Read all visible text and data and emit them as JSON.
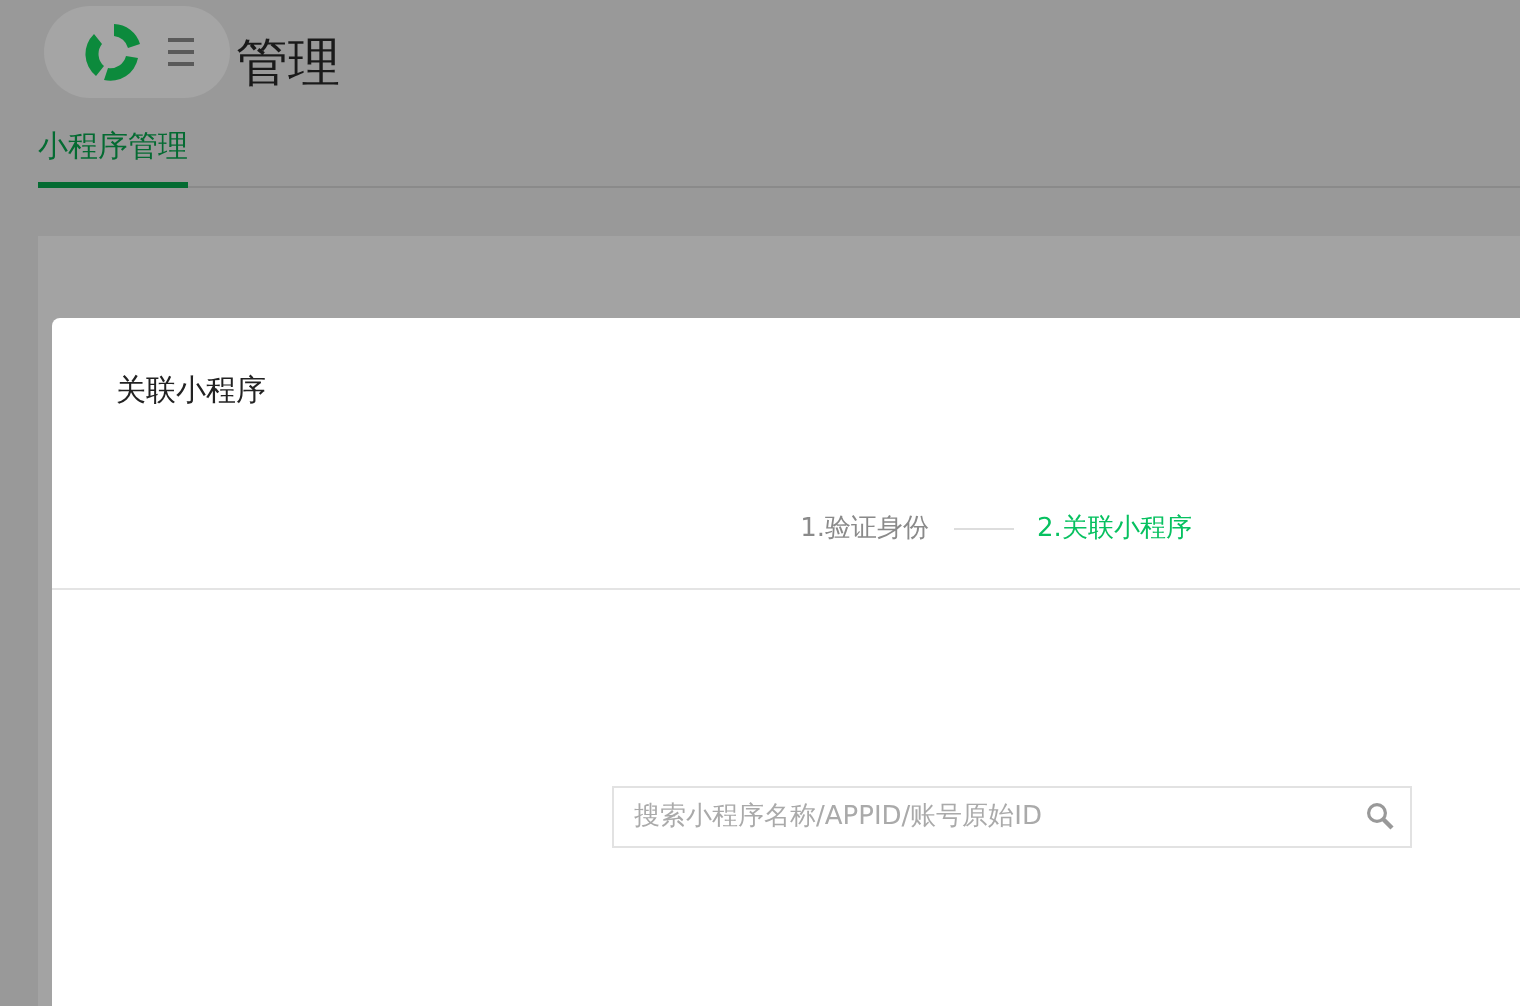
{
  "page": {
    "title": "管理"
  },
  "tabs": [
    {
      "label": "小程序管理",
      "selected": true
    }
  ],
  "dialog": {
    "title": "关联小程序",
    "steps": [
      {
        "label": "1.验证身份",
        "selected": false
      },
      {
        "label": "2.关联小程序",
        "selected": true
      }
    ],
    "search": {
      "placeholder": "搜索小程序名称/APPID/账号原始ID"
    }
  }
}
